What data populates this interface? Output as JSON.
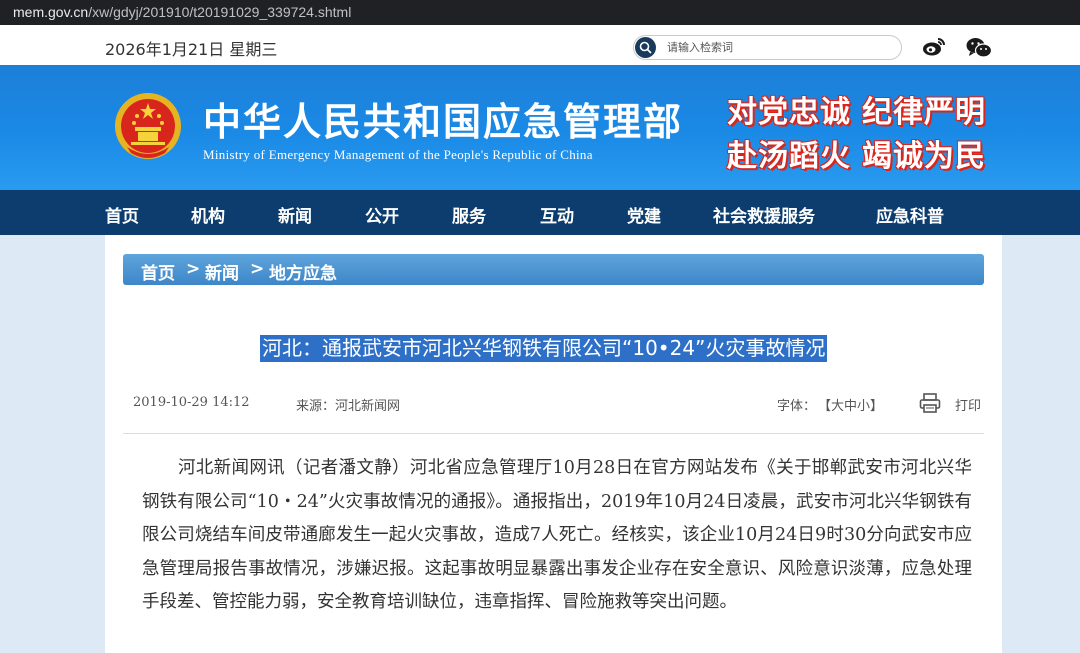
{
  "browser": {
    "url_host": "mem.gov.cn",
    "url_path": "/xw/gdyj/201910/t20191029_339724.shtml"
  },
  "topbar": {
    "date": "2026年1月21日 星期三",
    "search_placeholder": "请输入检索词",
    "icons": [
      "search-icon",
      "weibo-icon",
      "wechat-icon"
    ]
  },
  "banner": {
    "title": "中华人民共和国应急管理部",
    "subtitle": "Ministry of Emergency Management of the People's Republic of China",
    "motto": [
      "对党忠诚",
      "纪律严明",
      "赴汤蹈火",
      "竭诚为民"
    ]
  },
  "nav": {
    "items": [
      "首页",
      "机构",
      "新闻",
      "公开",
      "服务",
      "互动",
      "党建",
      "社会救援服务",
      "应急科普"
    ]
  },
  "breadcrumb": {
    "items": [
      "首页",
      "新闻",
      "地方应急"
    ],
    "separator": ">"
  },
  "article": {
    "title": "河北：通报武安市河北兴华钢铁有限公司“10•24”火灾事故情况",
    "datetime": "2019-10-29 14:12",
    "source": "来源：河北新闻网",
    "font_label": "字体：",
    "font_sizes": "【大中小】",
    "print_label": "打印",
    "body": "河北新闻网讯（记者潘文静）河北省应急管理厅10月28日在官方网站发布《关于邯郸武安市河北兴华钢铁有限公司“10・24”火灾事故情况的通报》。通报指出，2019年10月24日凌晨，武安市河北兴华钢铁有限公司烧结车间皮带通廊发生一起火灾事故，造成7人死亡。经核实，该企业10月24日9时30分向武安市应急管理局报告事故情况，涉嫌迟报。这起事故明显暴露出事发企业存在安全意识、风险意识淡薄，应急处理手段差、管控能力弱，安全教育培训缺位，违章指挥、冒险施救等突出问题。"
  },
  "colors": {
    "banner_blue": "#1a8ae6",
    "nav_navy": "#0c3d6e",
    "crumb_blue": "#4a92d2",
    "motto_red": "#d8261c",
    "title_highlight": "#2e70c7"
  }
}
